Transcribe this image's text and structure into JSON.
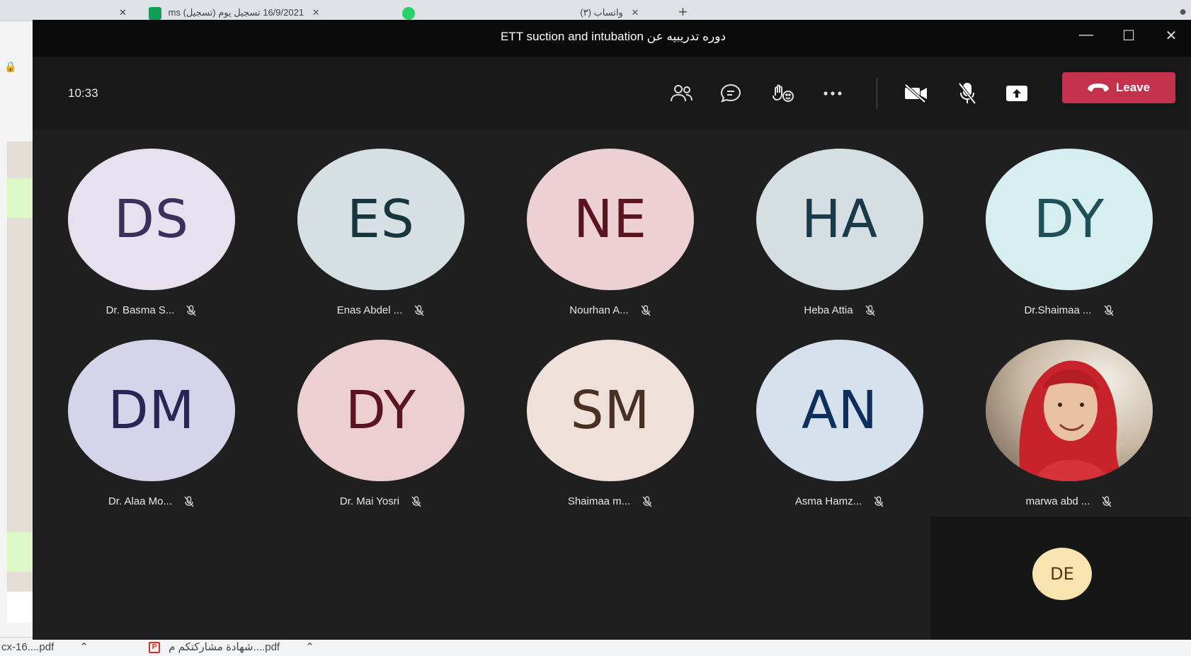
{
  "browser": {
    "tabs": [
      {
        "label": "ms (تسجيل) 16/9/2021 تسجيل يوم"
      },
      {
        "label": "(٣) واتساب"
      }
    ],
    "downloads": [
      {
        "label": "cx-16....pdf"
      },
      {
        "label": "شهادة مشاركتكم م....pdf"
      }
    ]
  },
  "window": {
    "title": "ETT suction and intubation دوره تدريبيه عن",
    "controls": {
      "minimize": "—",
      "maximize": "☐",
      "close": "✕"
    }
  },
  "toolbar": {
    "timer": "10:33",
    "leave_label": "Leave",
    "icons": [
      "participants-icon",
      "chat-icon",
      "reactions-icon",
      "more-options-icon",
      "camera-off-icon",
      "mic-off-icon",
      "share-screen-icon",
      "phone-hangup-icon"
    ]
  },
  "participants": [
    {
      "initials": "DS",
      "name": "Dr. Basma S...",
      "bg": "#e6e0ef",
      "fg": "#3b2f5c"
    },
    {
      "initials": "ES",
      "name": "Enas Abdel ...",
      "bg": "#d6e0e4",
      "fg": "#16353d"
    },
    {
      "initials": "NE",
      "name": "Nourhan A...",
      "bg": "#ecd0d3",
      "fg": "#5a1420"
    },
    {
      "initials": "HA",
      "name": "Heba Attia",
      "bg": "#d5dee2",
      "fg": "#1a3a4a"
    },
    {
      "initials": "DY",
      "name": "Dr.Shaimaa ...",
      "bg": "#d6eef0",
      "fg": "#1d5157"
    },
    {
      "initials": "DM",
      "name": "Dr. Alaa Mo...",
      "bg": "#d6d4ea",
      "fg": "#2b2556"
    },
    {
      "initials": "DY",
      "name": "Dr. Mai Yosri",
      "bg": "#eccfd1",
      "fg": "#5a1420"
    },
    {
      "initials": "SM",
      "name": "Shaimaa m...",
      "bg": "#efe0d9",
      "fg": "#4a3024"
    },
    {
      "initials": "AN",
      "name": "Asma Hamz...",
      "bg": "#d6e1ee",
      "fg": "#0e2f5c"
    },
    {
      "initials": "",
      "name": "marwa abd ...",
      "bg": "#b8a38f",
      "fg": "#000000",
      "photo": true
    }
  ],
  "self": {
    "initials": "DE"
  },
  "colors": {
    "leave": "#c4314b",
    "titlebar": "#0b0b0b",
    "stage": "#1f1f1f"
  }
}
